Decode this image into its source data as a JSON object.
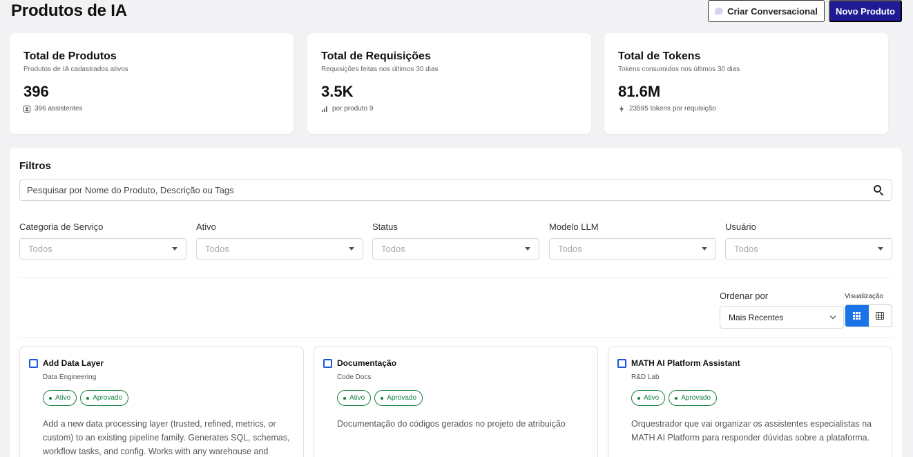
{
  "header": {
    "title": "Produtos de IA",
    "btn_conversational": "Criar Conversacional",
    "btn_new": "Novo Produto"
  },
  "stats": [
    {
      "title": "Total de Produtos",
      "subtitle": "Produtos de IA cadastrados ativos",
      "value": "396",
      "footer": "396 assistentes",
      "icon": "assistant-icon"
    },
    {
      "title": "Total de Requisições",
      "subtitle": "Requisições feitas nos últimos 30 dias",
      "value": "3.5K",
      "footer": "por produto 9",
      "icon": "bar-chart-icon"
    },
    {
      "title": "Total de Tokens",
      "subtitle": "Tokens consumidos nos últimos 30 dias",
      "value": "81.6M",
      "footer": "23595 tokens por requisição",
      "icon": "lightning-icon"
    }
  ],
  "filters": {
    "title": "Filtros",
    "search_placeholder": "Pesquisar por Nome do Produto, Descrição ou Tags",
    "groups": [
      {
        "label": "Categoria de Serviço",
        "value": "Todos"
      },
      {
        "label": "Ativo",
        "value": "Todos"
      },
      {
        "label": "Status",
        "value": "Todos"
      },
      {
        "label": "Modelo LLM",
        "value": "Todos"
      },
      {
        "label": "Usuário",
        "value": "Todos"
      }
    ]
  },
  "sort": {
    "label": "Ordenar por",
    "value": "Mais Recentes",
    "view_label": "Visualização",
    "view_active": "grid"
  },
  "products": [
    {
      "title": "Add Data Layer",
      "category": "Data Engineering",
      "badges": [
        "Ativo",
        "Aprovado"
      ],
      "description": "Add a new data processing layer (trusted, refined, metrics, or custom) to an existing pipeline family. Generates SQL, schemas, workflow tasks, and config. Works with any warehouse and"
    },
    {
      "title": "Documentação",
      "category": "Code Docs",
      "badges": [
        "Ativo",
        "Aprovado"
      ],
      "description": "Documentação do códigos gerados no projeto de atribuição"
    },
    {
      "title": "MATH AI Platform Assistant",
      "category": "R&D Lab",
      "badges": [
        "Ativo",
        "Aprovado"
      ],
      "description": "Orquestrador que vai organizar os assistentes especialistas na MATH AI Platform para responder dúvidas sobre a plataforma."
    }
  ],
  "colors": {
    "primary": "#1e1b94",
    "accent": "#1a73e8",
    "success": "#15803d",
    "checkbox": "#1a56db"
  }
}
